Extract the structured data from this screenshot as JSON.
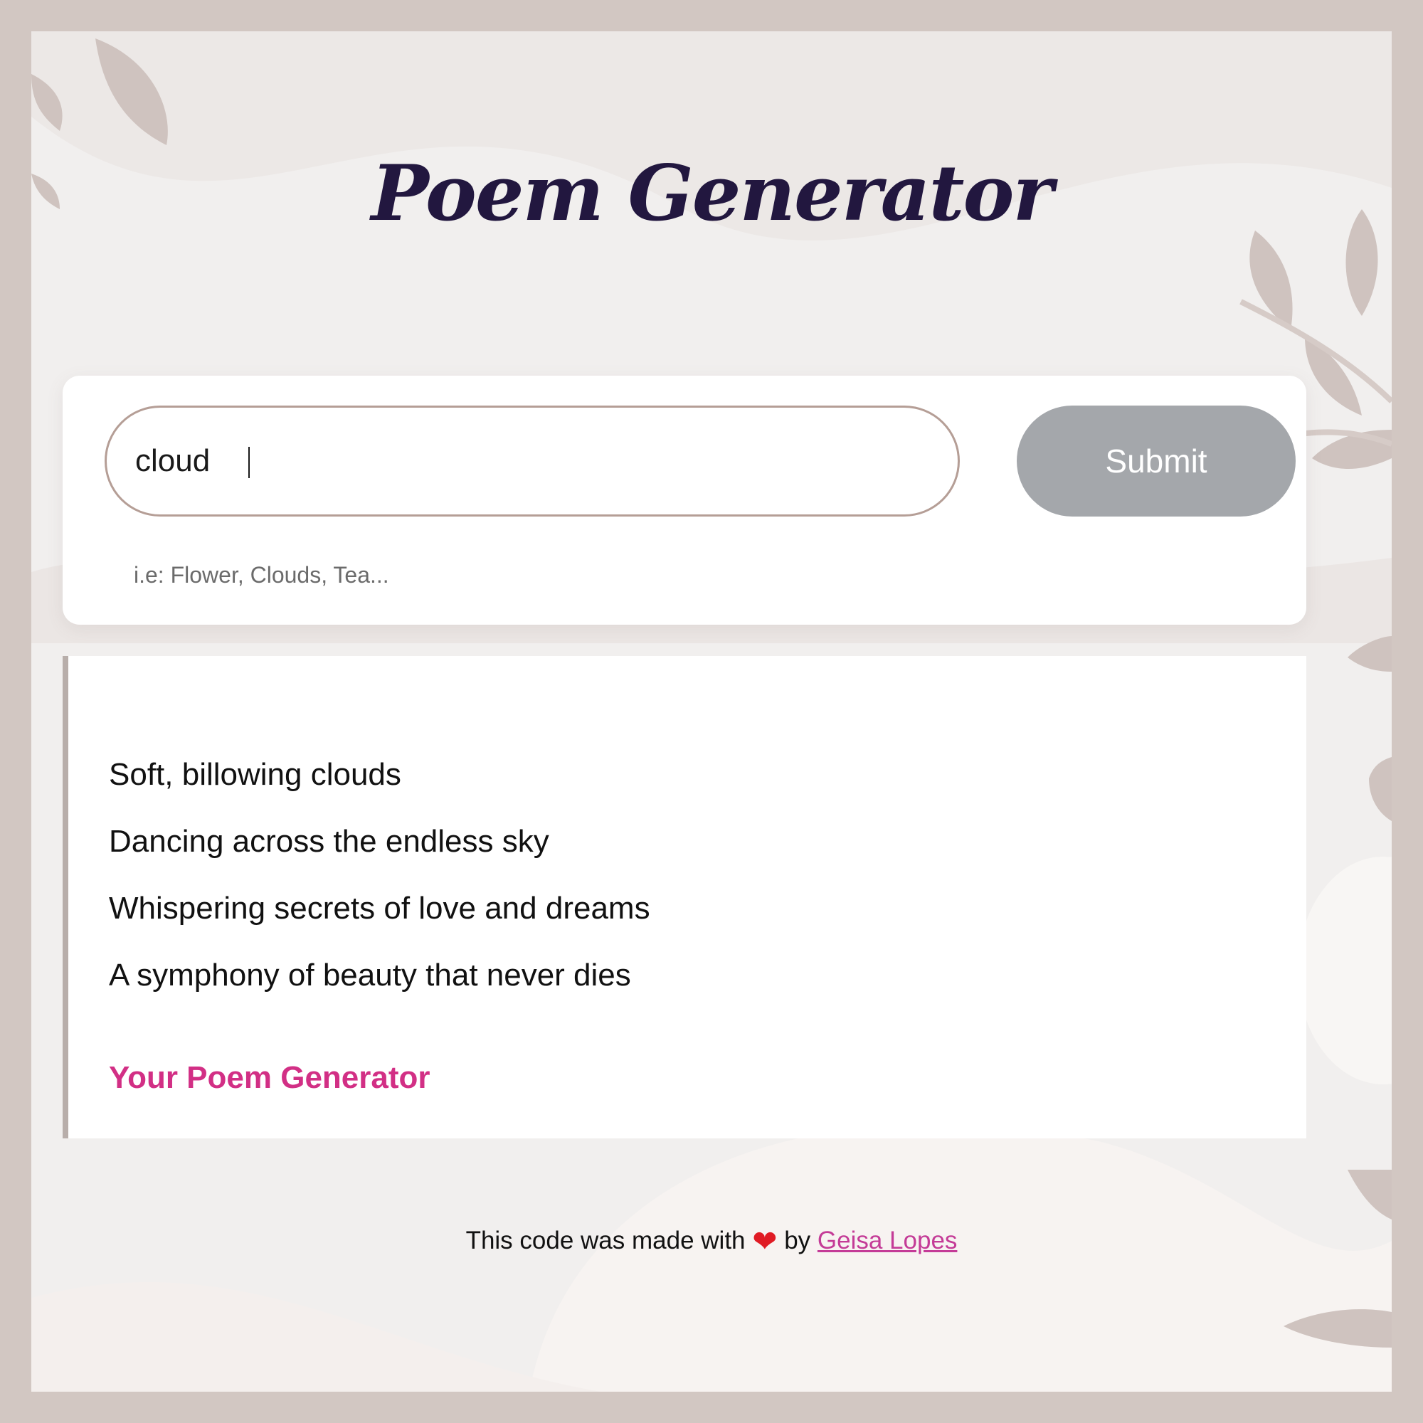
{
  "app": {
    "title": "Poem Generator"
  },
  "form": {
    "input_value": "cloud",
    "hint": "i.e: Flower, Clouds, Tea...",
    "submit_label": "Submit"
  },
  "poem": {
    "lines": [
      "Soft, billowing clouds",
      "Dancing across the endless sky",
      "Whispering secrets of love and dreams",
      "A symphony of beauty that never dies"
    ],
    "signature": "Your Poem Generator"
  },
  "footer": {
    "prefix": "This code was made with",
    "heart_icon": "heart-icon",
    "by": "by",
    "author": "Geisa Lopes"
  },
  "colors": {
    "title": "#22173f",
    "signature": "#d22f85",
    "submit_bg": "#a4a7ab",
    "input_border": "#b59e96",
    "link": "#c43b97",
    "heart": "#e01b24"
  }
}
